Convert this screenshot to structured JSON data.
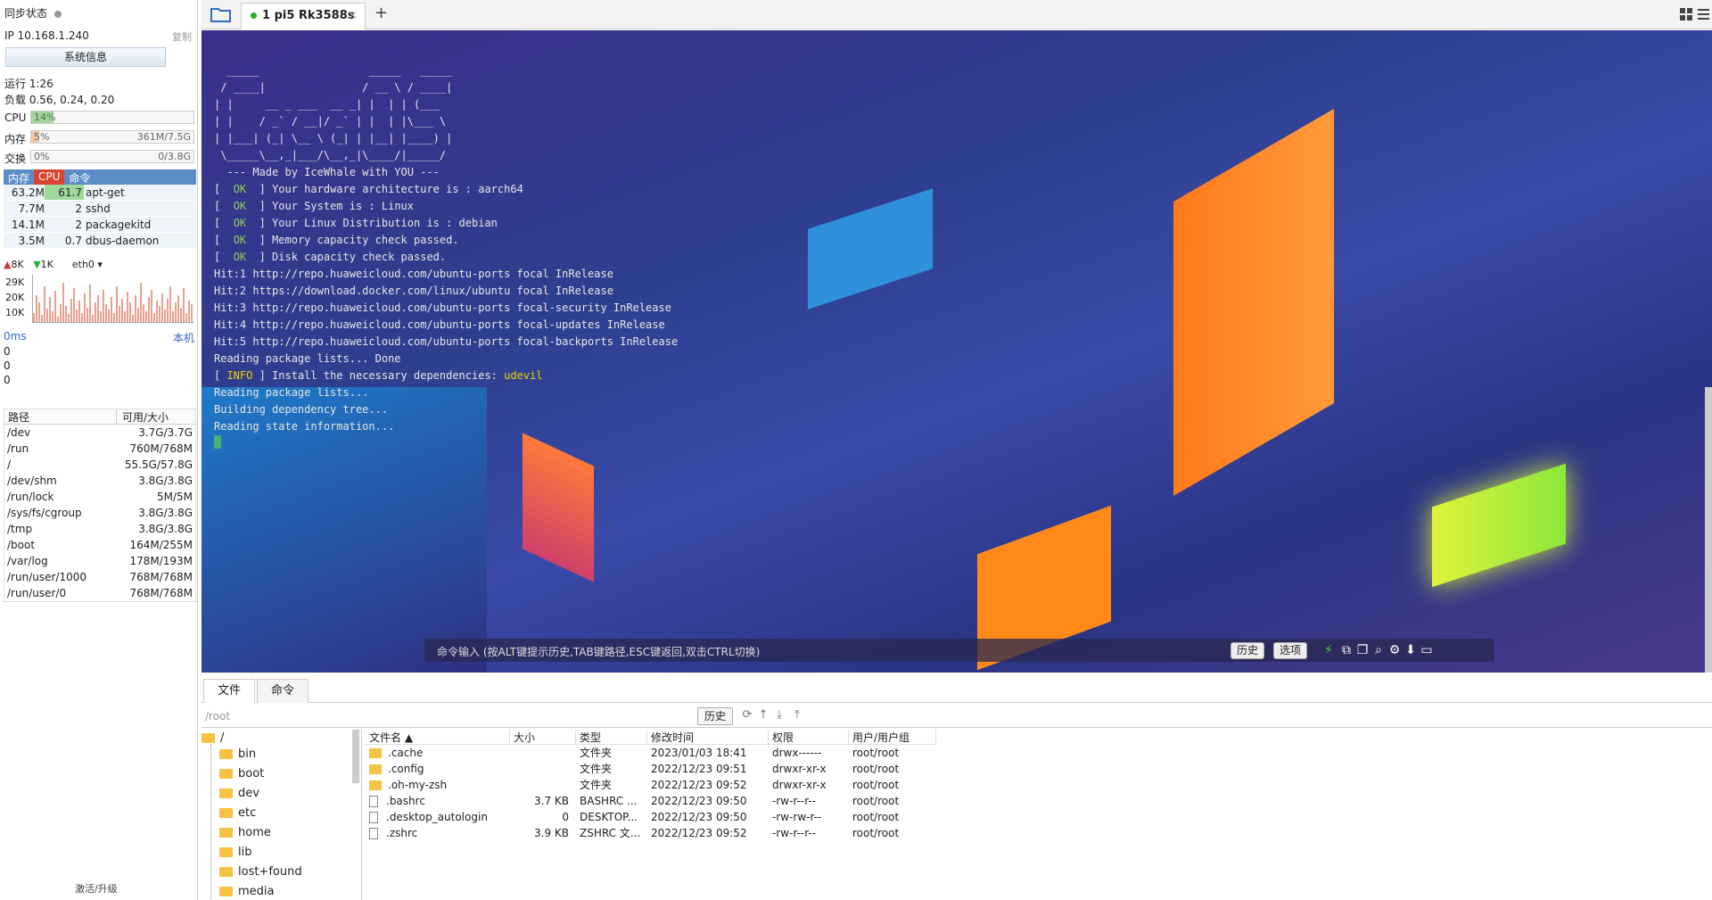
{
  "sidebar": {
    "sync_label": "同步状态",
    "ip": "IP 10.168.1.240",
    "copy": "复制",
    "sysinfo": "系统信息",
    "uptime": "运行 1:26",
    "load": "负载 0.56, 0.24, 0.20",
    "cpu": {
      "label": "CPU",
      "pct": "14%",
      "value": 14
    },
    "mem": {
      "label": "内存",
      "pct": "5%",
      "detail": "361M/7.5G",
      "value": 5
    },
    "swap": {
      "label": "交换",
      "pct": "0%",
      "detail": "0/3.8G",
      "value": 0
    },
    "proc_headers": [
      "内存",
      "CPU",
      "命令"
    ],
    "processes": [
      {
        "mem": "63.2M",
        "cpu": "61.7",
        "cmd": "apt-get"
      },
      {
        "mem": "7.7M",
        "cpu": "2",
        "cmd": "sshd"
      },
      {
        "mem": "14.1M",
        "cpu": "2",
        "cmd": "packagekitd"
      },
      {
        "mem": "3.5M",
        "cpu": "0.7",
        "cmd": "dbus-daemon"
      }
    ],
    "net_up": "8K",
    "net_down": "1K",
    "net_iface": "eth0",
    "net_ticks": [
      "29K",
      "20K",
      "10K"
    ],
    "ping": "0ms",
    "ping_host": "本机",
    "ping_vals": [
      "0",
      "0",
      "0"
    ],
    "disk_headers": [
      "路径",
      "可用/大小"
    ],
    "disks": [
      {
        "path": "/dev",
        "size": "3.7G/3.7G"
      },
      {
        "path": "/run",
        "size": "760M/768M"
      },
      {
        "path": "/",
        "size": "55.5G/57.8G"
      },
      {
        "path": "/dev/shm",
        "size": "3.8G/3.8G"
      },
      {
        "path": "/run/lock",
        "size": "5M/5M"
      },
      {
        "path": "/sys/fs/cgroup",
        "size": "3.8G/3.8G"
      },
      {
        "path": "/tmp",
        "size": "3.8G/3.8G"
      },
      {
        "path": "/boot",
        "size": "164M/255M"
      },
      {
        "path": "/var/log",
        "size": "178M/193M"
      },
      {
        "path": "/run/user/1000",
        "size": "768M/768M"
      },
      {
        "path": "/run/user/0",
        "size": "768M/768M"
      }
    ],
    "activate": "激活/升级"
  },
  "tabs": {
    "active": "1 pi5 Rk3588s",
    "close": "×",
    "add": "+"
  },
  "terminal": {
    "banner": [
      "  _____                 _____   _____",
      " / ____|               / __ \\ / ____|",
      "| |     __ _ ___  __ _| |  | | (___",
      "| |    / _` / __|/ _` | |  | |\\___ \\",
      "| |___| (_| \\__ \\ (_| | |__| |____) |",
      " \\_____\\__,_|___/\\__,_|\\____/|_____/",
      "",
      "  --- Made by IceWhale with YOU ---",
      ""
    ],
    "ok_lines": [
      "Your hardware architecture is : aarch64",
      "Your System is : Linux",
      "Your Linux Distribution is : debian",
      "Memory capacity check passed.",
      "Disk capacity check passed."
    ],
    "ok_tag": "OK",
    "hit_lines": [
      "Hit:1 http://repo.huaweicloud.com/ubuntu-ports focal InRelease",
      "Hit:2 https://download.docker.com/linux/ubuntu focal InRelease",
      "Hit:3 http://repo.huaweicloud.com/ubuntu-ports focal-security InRelease",
      "Hit:4 http://repo.huaweicloud.com/ubuntu-ports focal-updates InRelease",
      "Hit:5 http://repo.huaweicloud.com/ubuntu-ports focal-backports InRelease",
      "Reading package lists... Done"
    ],
    "info_tag": "INFO",
    "info_text": "Install the necessary dependencies: ",
    "info_pkg": "udevil",
    "tail_lines": [
      "Reading package lists...",
      "Building dependency tree...",
      "Reading state information..."
    ],
    "cmd_placeholder": "命令输入 (按ALT键提示历史,TAB键路径,ESC键返回,双击CTRL切换)",
    "history_btn": "历史",
    "options_btn": "选项"
  },
  "files": {
    "tabs": [
      "文件",
      "命令"
    ],
    "path": "/root",
    "history": "历史",
    "tree_root": "/",
    "tree": [
      "bin",
      "boot",
      "dev",
      "etc",
      "home",
      "lib",
      "lost+found",
      "media"
    ],
    "columns": [
      "文件名 ▲",
      "大小",
      "类型",
      "修改时间",
      "权限",
      "用户/用户组"
    ],
    "rows": [
      {
        "name": ".cache",
        "size": "",
        "type": "文件夹",
        "mtime": "2023/01/03 18:41",
        "perm": "drwx------",
        "owner": "root/root",
        "dir": true
      },
      {
        "name": ".config",
        "size": "",
        "type": "文件夹",
        "mtime": "2022/12/23 09:51",
        "perm": "drwxr-xr-x",
        "owner": "root/root",
        "dir": true
      },
      {
        "name": ".oh-my-zsh",
        "size": "",
        "type": "文件夹",
        "mtime": "2022/12/23 09:52",
        "perm": "drwxr-xr-x",
        "owner": "root/root",
        "dir": true
      },
      {
        "name": ".bashrc",
        "size": "3.7 KB",
        "type": "BASHRC ...",
        "mtime": "2022/12/23 09:50",
        "perm": "-rw-r--r--",
        "owner": "root/root",
        "dir": false
      },
      {
        "name": ".desktop_autologin",
        "size": "0",
        "type": "DESKTOP...",
        "mtime": "2022/12/23 09:50",
        "perm": "-rw-rw-r--",
        "owner": "root/root",
        "dir": false
      },
      {
        "name": ".zshrc",
        "size": "3.9 KB",
        "type": "ZSHRC 文...",
        "mtime": "2022/12/23 09:52",
        "perm": "-rw-r--r--",
        "owner": "root/root",
        "dir": false
      }
    ]
  },
  "colors": {
    "accent": "#5b8cc6",
    "cpu_red": "#d9432f",
    "ok_green": "#8fd14f"
  }
}
